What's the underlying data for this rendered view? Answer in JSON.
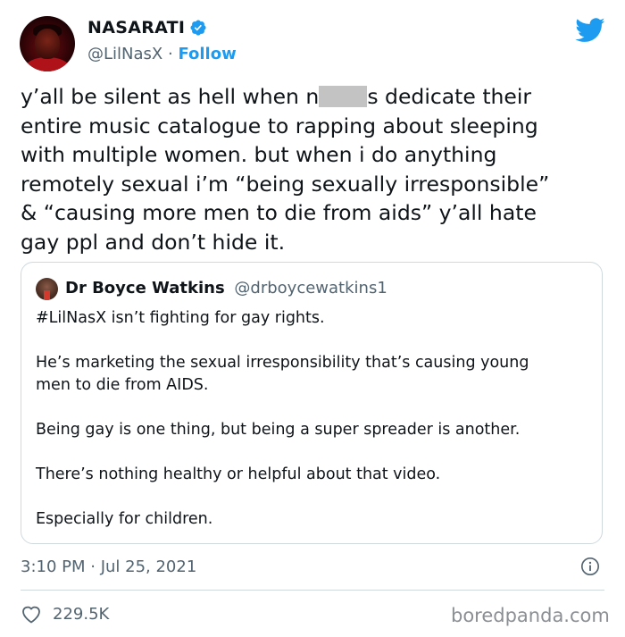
{
  "colors": {
    "accent": "#1d9bf0",
    "text": "#0f1419",
    "secondary_text": "#536471",
    "border": "#cfd9de",
    "redaction": "#c3c3c3"
  },
  "author": {
    "display_name": "NASARATI",
    "verified_icon": "verified-badge-icon",
    "handle": "@LilNasX",
    "separator": "·",
    "follow_label": "Follow"
  },
  "platform_icon": "twitter-bird-icon",
  "tweet": {
    "lines": [
      {
        "before": "y’all be silent as hell when n",
        "after": "s dedicate their"
      },
      "entire music catalogue to rapping about sleeping",
      "with multiple women. but when i do anything",
      "remotely sexual i’m “being sexually irresponsible”",
      "& “causing more men to die from aids” y’all hate",
      "gay ppl and don’t hide it."
    ]
  },
  "quoted_tweet": {
    "display_name": "Dr Boyce Watkins",
    "handle": "@drboycewatkins1",
    "paragraphs": [
      "#LilNasX isn’t fighting for gay rights.",
      "He’s marketing the sexual irresponsibility that’s causing young",
      "men to die from AIDS.",
      "Being gay is one thing, but being a super spreader is another.",
      "There’s nothing healthy or helpful about that video.",
      "Especially for children."
    ]
  },
  "timestamp": "3:10 PM · Jul 25, 2021",
  "info_icon": "info-icon",
  "like_icon": "heart-icon",
  "like_count": "229.5K",
  "watermark": "boredpanda.com"
}
